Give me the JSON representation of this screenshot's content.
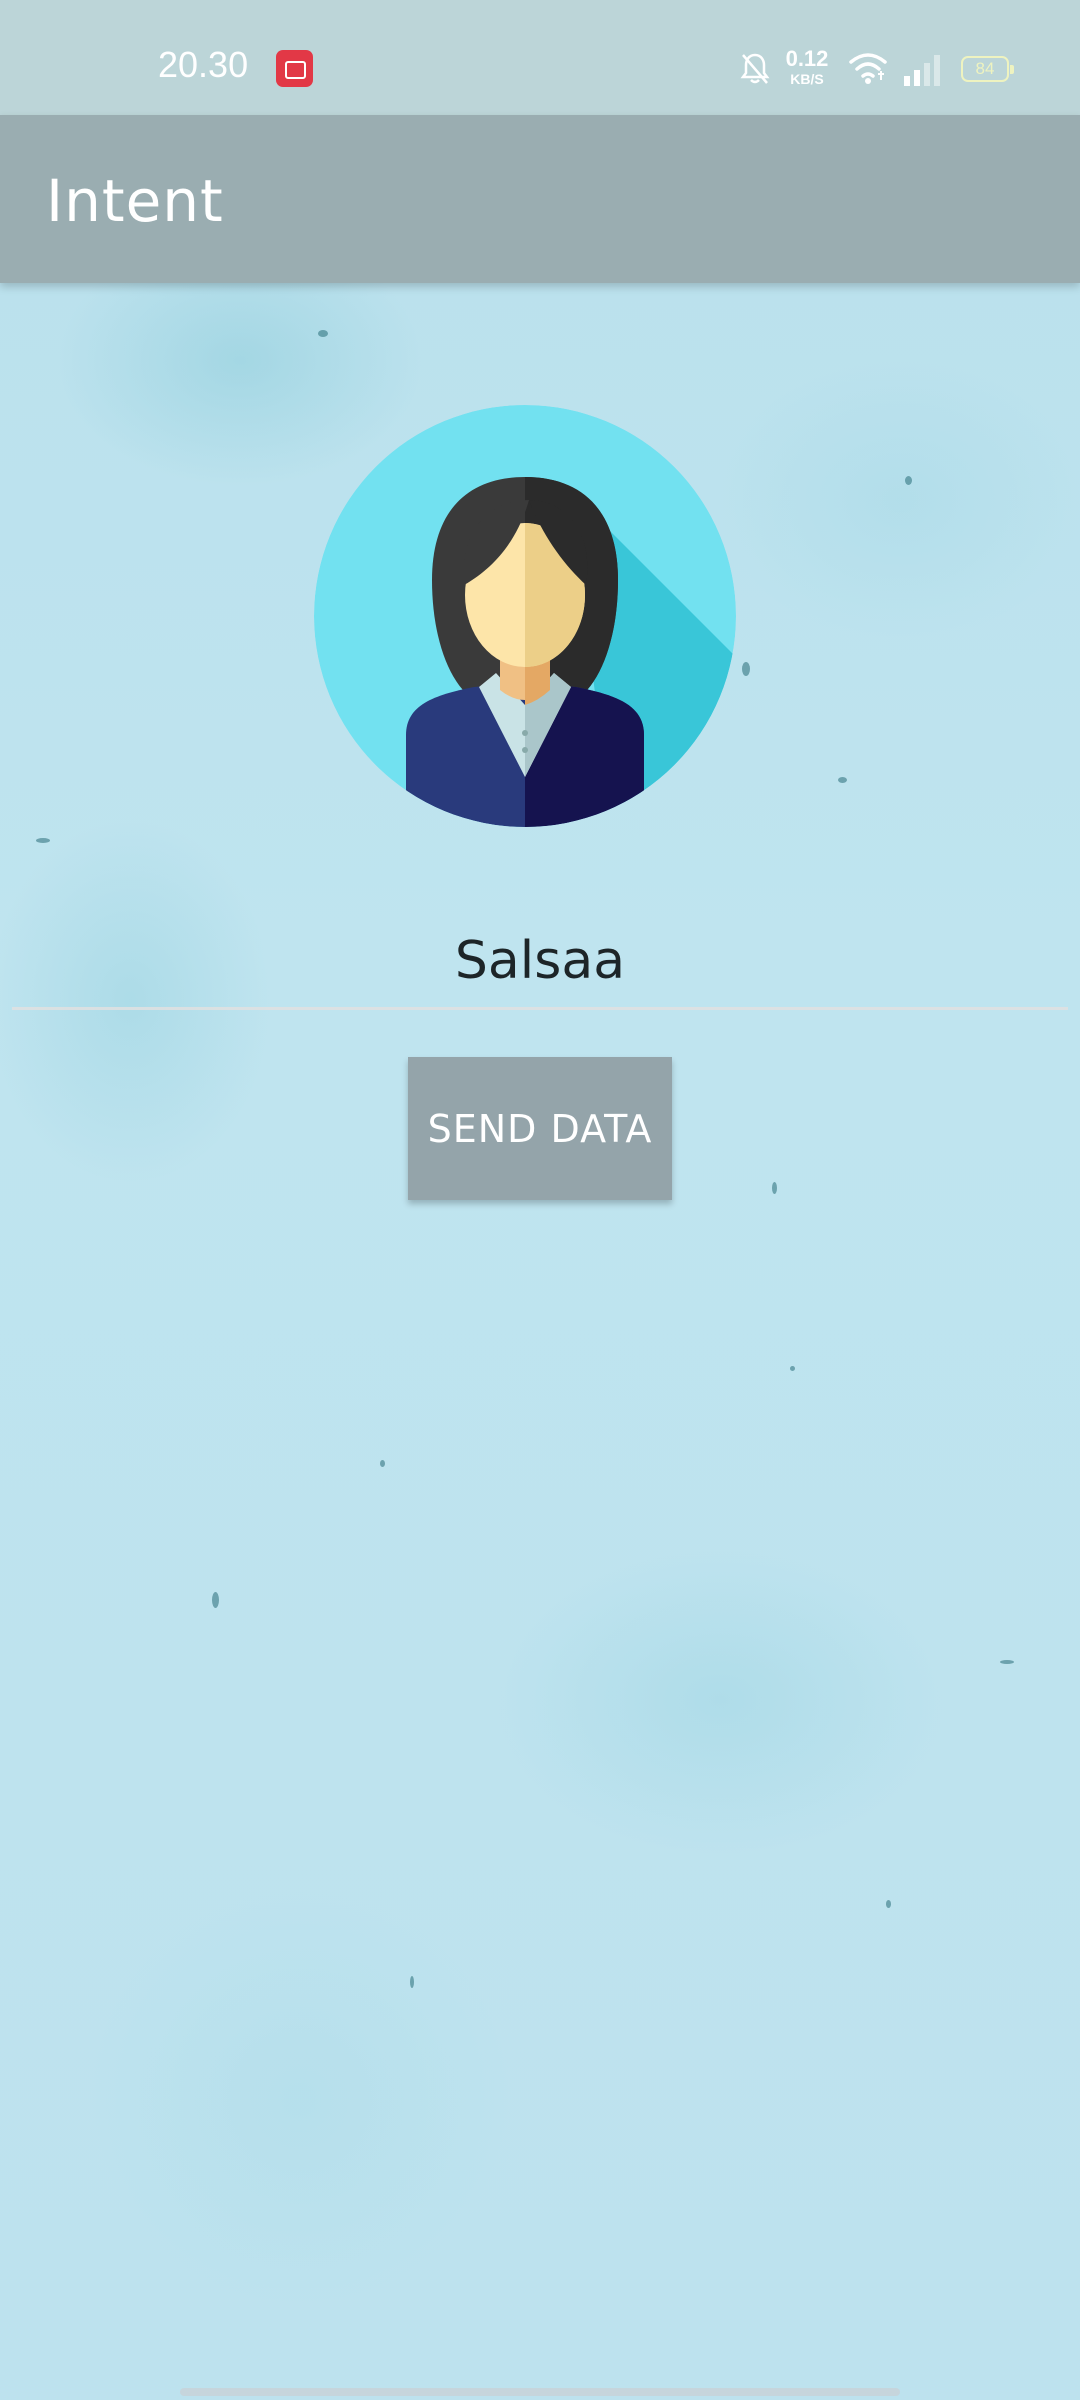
{
  "status_bar": {
    "time": "20.30",
    "net_speed_value": "0.12",
    "net_speed_unit": "KB/S",
    "battery_level": "84",
    "icons": [
      "screen-record-icon",
      "bell-off-icon",
      "wifi-icon",
      "signal-icon",
      "battery-icon"
    ]
  },
  "toolbar": {
    "title": "Intent"
  },
  "profile": {
    "avatar_icon": "female-avatar-icon",
    "name_value": "Salsaa"
  },
  "actions": {
    "send_label": "SEND DATA"
  },
  "colors": {
    "status_bar": "#bcd5d8",
    "toolbar": "#9aadb1",
    "button": "#94a4aa",
    "background": "#bde3ee",
    "record_badge": "#e23846"
  }
}
